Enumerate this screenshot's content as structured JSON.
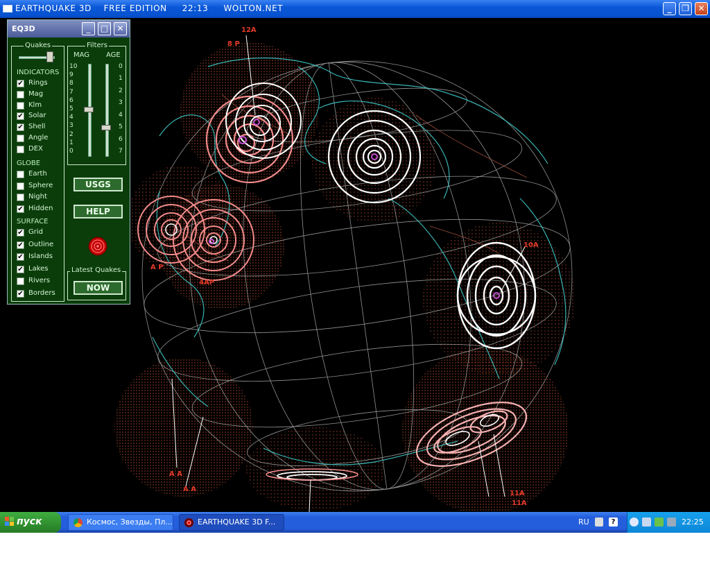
{
  "window": {
    "title": "EARTHQUAKE 3D    FREE EDITION     22:13     WOLTON.NET",
    "icon": "app-window-icon",
    "minimize": "_",
    "restore": "❐",
    "close": "✕"
  },
  "scene": {
    "labels": [
      {
        "text": "12A"
      },
      {
        "text": "8 P"
      },
      {
        "text": "10A"
      },
      {
        "text": "4AP"
      },
      {
        "text": "A P"
      },
      {
        "text": "A A"
      },
      {
        "text": "A A"
      },
      {
        "text": "11A"
      },
      {
        "text": "11A"
      }
    ],
    "colors": {
      "coast": "#3fc9c9",
      "grid": "#b8b8b8",
      "shell": "#e0603a",
      "ring_white": "#ffffff",
      "ring_pink": "#f28a8a"
    }
  },
  "panel": {
    "title": "EQ3D",
    "minimize": "_",
    "restore": "□",
    "close": "✕",
    "quakes_label": "Quakes",
    "filters_label": "Filters",
    "mag_label": "MAG",
    "age_label": "AGE",
    "mag_ticks": [
      "10",
      "9",
      "8",
      "7",
      "6",
      "5",
      "4",
      "3",
      "2",
      "1",
      "0"
    ],
    "age_ticks": [
      "0",
      "1",
      "2",
      "3",
      "4",
      "5",
      "6",
      "7"
    ],
    "mag_value": 5,
    "age_value": 5,
    "indicators_label": "INDICATORS",
    "indicators": [
      {
        "label": "Rings",
        "checked": true
      },
      {
        "label": "Mag",
        "checked": false
      },
      {
        "label": "Klm",
        "checked": false
      },
      {
        "label": "Solar",
        "checked": true
      },
      {
        "label": "Shell",
        "checked": true
      },
      {
        "label": "Angle",
        "checked": false
      },
      {
        "label": "DEX",
        "checked": false
      }
    ],
    "globe_label": "GLOBE",
    "globe": [
      {
        "label": "Earth",
        "checked": false
      },
      {
        "label": "Sphere",
        "checked": false
      },
      {
        "label": "Night",
        "checked": false
      },
      {
        "label": "Hidden",
        "checked": true
      }
    ],
    "surface_label": "SURFACE",
    "surface": [
      {
        "label": "Grid",
        "checked": true
      },
      {
        "label": "Outline",
        "checked": true
      },
      {
        "label": "Islands",
        "checked": true
      },
      {
        "label": "Lakes",
        "checked": true
      },
      {
        "label": "Rivers",
        "checked": false
      },
      {
        "label": "Borders",
        "checked": true
      }
    ],
    "usgs_label": "USGS",
    "help_label": "HELP",
    "latest_label": "Latest Quakes",
    "now_label": "NOW",
    "check_mark": "✔"
  },
  "taskbar": {
    "start_label": "пуск",
    "tasks": [
      {
        "label": "Космос, Звезды, Пл...",
        "icon": "chrome-icon",
        "active": false
      },
      {
        "label": "EARTHQUAKE 3D    F...",
        "icon": "eq3d-icon",
        "active": true
      }
    ],
    "language": "RU",
    "clock": "22:25"
  }
}
